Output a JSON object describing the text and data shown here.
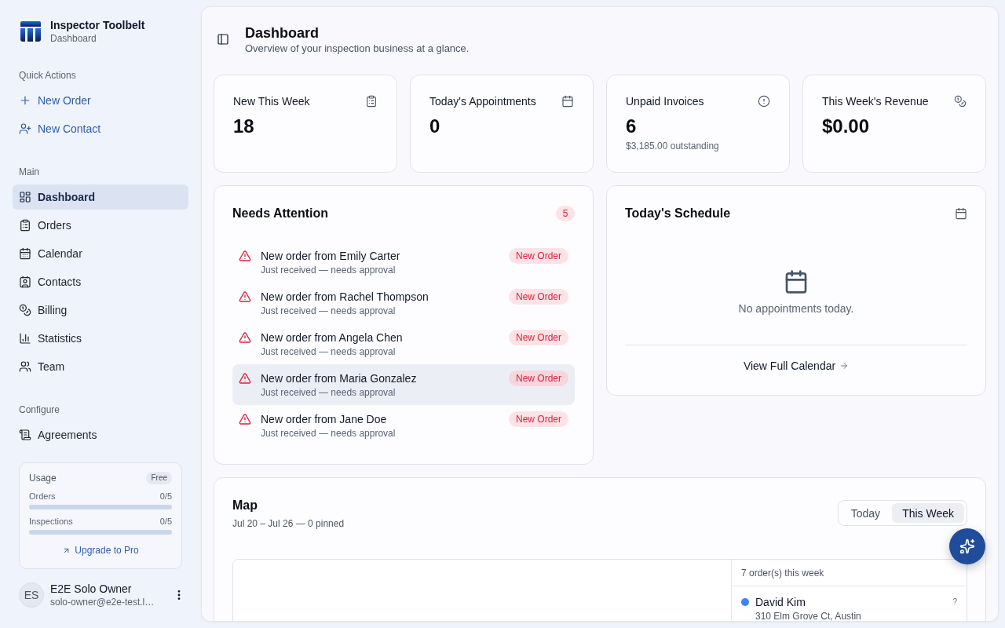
{
  "sidebar": {
    "brand": {
      "title": "Inspector Toolbelt",
      "subtitle": "Dashboard"
    },
    "sections": [
      {
        "label": "Quick Actions",
        "kind": "actions",
        "items": [
          {
            "label": "New Order"
          },
          {
            "label": "New Contact"
          }
        ]
      },
      {
        "label": "Main",
        "kind": "nav",
        "items": [
          {
            "label": "Dashboard",
            "selected": true
          },
          {
            "label": "Orders",
            "selected": false
          },
          {
            "label": "Calendar",
            "selected": false
          },
          {
            "label": "Contacts",
            "selected": false
          },
          {
            "label": "Billing",
            "selected": false
          },
          {
            "label": "Statistics",
            "selected": false
          },
          {
            "label": "Team",
            "selected": false
          }
        ]
      },
      {
        "label": "Configure",
        "kind": "nav",
        "items": [
          {
            "label": "Agreements",
            "selected": false
          }
        ]
      }
    ],
    "usage": {
      "title": "Usage",
      "plan": "Free",
      "meters": [
        {
          "label": "Orders",
          "reading": "0/5"
        },
        {
          "label": "Inspections",
          "reading": "0/5"
        }
      ],
      "link": "Upgrade to Pro"
    },
    "user": {
      "initials": "ES",
      "name": "E2E Solo Owner",
      "email": "solo-owner@e2e-test.l…"
    }
  },
  "page_header": {
    "title": "Dashboard",
    "subtitle": "Overview of your inspection business at a glance."
  },
  "stats": [
    {
      "label": "New This Week",
      "value": "18"
    },
    {
      "label": "Today's Appointments",
      "value": "0"
    },
    {
      "label": "Unpaid Invoices",
      "value": "6",
      "note": "$3,185.00 outstanding"
    },
    {
      "label": "This Week's Revenue",
      "value": "$0.00"
    }
  ],
  "needs_attention": {
    "title": "Needs Attention",
    "count": "5",
    "items": [
      {
        "title": "New order from Emily Carter",
        "subtitle": "Just received — needs approval",
        "tag": "New Order",
        "highlighted": false
      },
      {
        "title": "New order from Rachel Thompson",
        "subtitle": "Just received — needs approval",
        "tag": "New Order",
        "highlighted": false
      },
      {
        "title": "New order from Angela Chen",
        "subtitle": "Just received — needs approval",
        "tag": "New Order",
        "highlighted": false
      },
      {
        "title": "New order from Maria Gonzalez",
        "subtitle": "Just received — needs approval",
        "tag": "New Order",
        "highlighted": true
      },
      {
        "title": "New order from Jane Doe",
        "subtitle": "Just received — needs approval",
        "tag": "New Order",
        "highlighted": false
      }
    ]
  },
  "schedule": {
    "title": "Today's Schedule",
    "empty_text": "No appointments today.",
    "link": "View Full Calendar"
  },
  "map": {
    "title": "Map",
    "subtitle": "Jul 20 – Jul 26 — 0 pinned",
    "ranges": [
      {
        "label": "Today",
        "selected": false
      },
      {
        "label": "This Week",
        "selected": true
      }
    ],
    "list_header": "7 order(s) this week",
    "orders": [
      {
        "name": "David Kim",
        "address": "310 Elm Grove Ct, Austin",
        "color": "#3b82f6",
        "status": "?"
      }
    ]
  }
}
